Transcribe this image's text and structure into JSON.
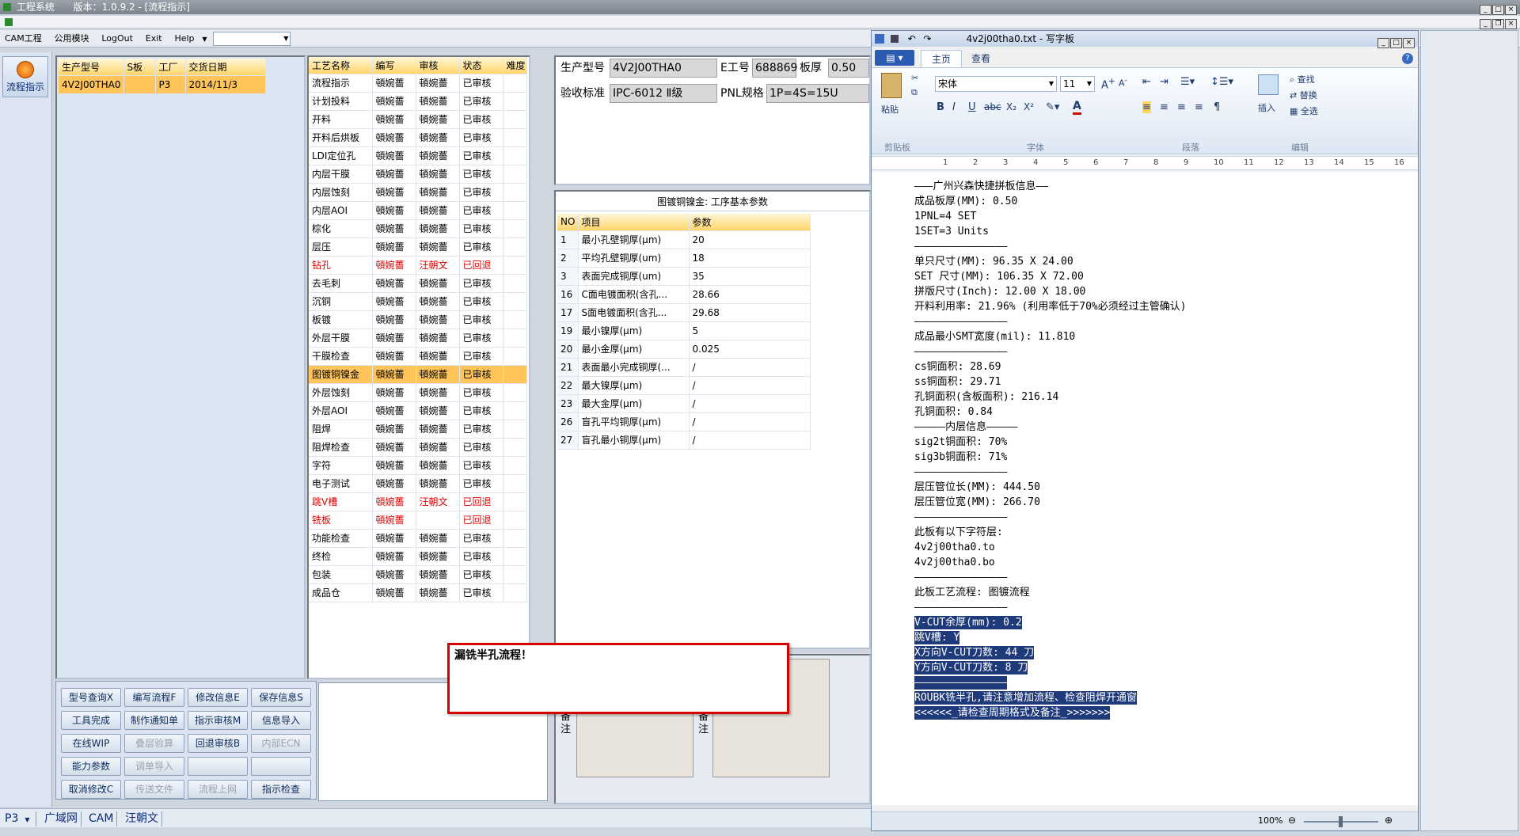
{
  "titlebar": {
    "app": "工程系统",
    "version": "版本：1.0.9.2 - [流程指示]"
  },
  "menubar": {
    "items": [
      "CAM工程",
      "公用模块",
      "LogOut",
      "Exit",
      "Help"
    ],
    "combo_value": ""
  },
  "leftnav": {
    "button_label": "流程指示"
  },
  "order_table": {
    "headers": [
      "生产型号",
      "S板",
      "工厂",
      "交货日期"
    ],
    "rows": [
      [
        "4V2J00THA0",
        "",
        "P3",
        "2014/11/3"
      ]
    ]
  },
  "process_table": {
    "headers": [
      "工艺名称",
      "编写",
      "审核",
      "状态",
      "难度"
    ],
    "rows": [
      [
        "流程指示",
        "頓婉薔",
        "頓婉薔",
        "已审核",
        ""
      ],
      [
        "计划投料",
        "頓婉薔",
        "頓婉薔",
        "已审核",
        ""
      ],
      [
        "开料",
        "頓婉薔",
        "頓婉薔",
        "已审核",
        ""
      ],
      [
        "开料后烘板",
        "頓婉薔",
        "頓婉薔",
        "已审核",
        ""
      ],
      [
        "LDI定位孔",
        "頓婉薔",
        "頓婉薔",
        "已审核",
        ""
      ],
      [
        "内层干膜",
        "頓婉薔",
        "頓婉薔",
        "已审核",
        ""
      ],
      [
        "内层蚀刻",
        "頓婉薔",
        "頓婉薔",
        "已审核",
        ""
      ],
      [
        "内层AOI",
        "頓婉薔",
        "頓婉薔",
        "已审核",
        ""
      ],
      [
        "棕化",
        "頓婉薔",
        "頓婉薔",
        "已审核",
        ""
      ],
      [
        "层压",
        "頓婉薔",
        "頓婉薔",
        "已审核",
        ""
      ],
      [
        "钻孔",
        "頓婉薔",
        "汪朝文",
        "已回退",
        ""
      ],
      [
        "去毛刺",
        "頓婉薔",
        "頓婉薔",
        "已审核",
        ""
      ],
      [
        "沉铜",
        "頓婉薔",
        "頓婉薔",
        "已审核",
        ""
      ],
      [
        "板镀",
        "頓婉薔",
        "頓婉薔",
        "已审核",
        ""
      ],
      [
        "外层干膜",
        "頓婉薔",
        "頓婉薔",
        "已审核",
        ""
      ],
      [
        "干膜检查",
        "頓婉薔",
        "頓婉薔",
        "已审核",
        ""
      ],
      [
        "图镀铜镍金",
        "頓婉薔",
        "頓婉薔",
        "已审核",
        ""
      ],
      [
        "外层蚀刻",
        "頓婉薔",
        "頓婉薔",
        "已审核",
        ""
      ],
      [
        "外层AOI",
        "頓婉薔",
        "頓婉薔",
        "已审核",
        ""
      ],
      [
        "阻焊",
        "頓婉薔",
        "頓婉薔",
        "已审核",
        ""
      ],
      [
        "阻焊检查",
        "頓婉薔",
        "頓婉薔",
        "已审核",
        ""
      ],
      [
        "字符",
        "頓婉薔",
        "頓婉薔",
        "已审核",
        ""
      ],
      [
        "电子测试",
        "頓婉薔",
        "頓婉薔",
        "已审核",
        ""
      ],
      [
        "跳V槽",
        "頓婉薔",
        "汪朝文",
        "已回退",
        ""
      ],
      [
        "铣板",
        "頓婉薔",
        "",
        "已回退",
        ""
      ],
      [
        "功能检查",
        "頓婉薔",
        "頓婉薔",
        "已审核",
        ""
      ],
      [
        "终检",
        "頓婉薔",
        "頓婉薔",
        "已审核",
        ""
      ],
      [
        "包装",
        "頓婉薔",
        "頓婉薔",
        "已审核",
        ""
      ],
      [
        "成品仓",
        "頓婉薔",
        "頓婉薔",
        "已审核",
        ""
      ]
    ],
    "selected": 16,
    "returned": [
      10,
      23,
      24
    ]
  },
  "info": {
    "prod_no_label": "生产型号",
    "prod_no": "4V2J00THA0",
    "e_no_label": "E工号",
    "e_no": "688869",
    "thick_label": "板厚",
    "thick": "0.50",
    "std_label": "验收标准",
    "std": "IPC-6012 Ⅱ级",
    "pnl_label": "PNL规格",
    "pnl": "1P=4S=15U"
  },
  "params": {
    "title": "图镀铜镍金: 工序基本参数",
    "headers": [
      "NO",
      "项目",
      "参数"
    ],
    "rows": [
      [
        "1",
        "最小孔壁铜厚(μm)",
        "20"
      ],
      [
        "2",
        "平均孔壁铜厚(um)",
        "18"
      ],
      [
        "3",
        "表面完成铜厚(um)",
        "35"
      ],
      [
        "16",
        "C面电镀面积(含孔...",
        "28.66"
      ],
      [
        "17",
        "S面电镀面积(含孔...",
        "29.68"
      ],
      [
        "19",
        "最小镍厚(μm)",
        "5"
      ],
      [
        "20",
        "最小金厚(μm)",
        "0.025"
      ],
      [
        "21",
        "表面最小完成铜厚(...",
        "/"
      ],
      [
        "22",
        "最大镍厚(μm)",
        "/"
      ],
      [
        "23",
        "最大金厚(μm)",
        "/"
      ],
      [
        "26",
        "盲孔平均铜厚(μm)",
        "/"
      ],
      [
        "27",
        "盲孔最小铜厚(μm)",
        "/"
      ]
    ]
  },
  "notes": {
    "label1": "备注",
    "label2": "备注"
  },
  "buttons": [
    [
      "型号查询X",
      "编写流程F",
      "修改信息E",
      "保存信息S"
    ],
    [
      "工具完成",
      "制作通知单",
      "指示审核M",
      "信息导入"
    ],
    [
      "在线WIP",
      "叠层验算",
      "回退审核B",
      "内部ECN"
    ],
    [
      "能力参数",
      "调单导入",
      "",
      ""
    ],
    [
      "取消修改C",
      "传送文件",
      "流程上网",
      "指示检查"
    ]
  ],
  "disabled_buttons": [
    "叠层验算",
    "内部ECN",
    "调单导入",
    "传送文件",
    "流程上网"
  ],
  "alert": {
    "text": "漏铣半孔流程！"
  },
  "statusbar": {
    "factory": "P3",
    "tabs": [
      "广域网",
      "CAM",
      "汪朝文"
    ]
  },
  "wordpad": {
    "title": "4v2j00tha0.txt - 写字板",
    "tabs": [
      "主页",
      "查看"
    ],
    "font": "宋体",
    "size": "11",
    "groups": [
      "剪贴板",
      "字体",
      "段落",
      "编辑"
    ],
    "paste": "粘贴",
    "insert": "插入",
    "find": "查找",
    "replace": "替换",
    "selectall": "全选",
    "zoom": "100%",
    "lines": [
      "———广州兴森快捷拼板信息——",
      "成品板厚(MM): 0.50",
      "1PNL=4 SET",
      "1SET=3 Units",
      "———————————————",
      "单只尺寸(MM): 96.35 X 24.00",
      "SET 尺寸(MM): 106.35 X 72.00",
      "拼版尺寸(Inch): 12.00 X 18.00",
      "开料利用率: 21.96% (利用率低于70%必须经过主管确认)",
      "———————————————",
      "成品最小SMT宽度(mil): 11.810",
      "———————————————",
      "cs铜面积: 28.69",
      "ss铜面积: 29.71",
      "孔铜面积(含板面积): 216.14",
      "孔铜面积: 0.84",
      "—————内层信息—————",
      "sig2t铜面积: 70%",
      "sig3b铜面积: 71%",
      "———————————————",
      "层压管位长(MM): 444.50",
      "层压管位宽(MM): 266.70",
      "———————————————",
      "此板有以下字符层:",
      "4v2j00tha0.to",
      "4v2j00tha0.bo",
      "———————————————",
      "此板工艺流程: 图镀流程",
      "———————————————",
      "V-CUT余厚(mm): 0.2",
      "跳V槽: Y",
      "X方向V-CUT刀数: 44 刀",
      "Y方向V-CUT刀数: 8 刀",
      "———————————————",
      "ROUBK铣半孔,请注意增加流程、检查阻焊开通窗",
      "<<<<<<_请检查周期格式及备注_>>>>>>>",
      ""
    ]
  }
}
